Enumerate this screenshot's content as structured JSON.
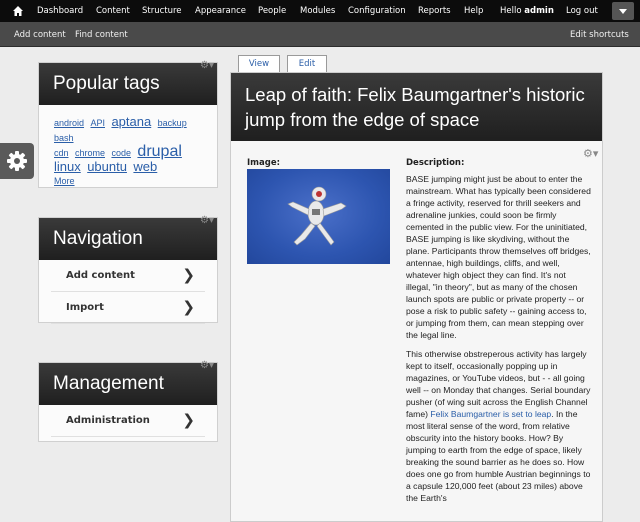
{
  "toolbar": {
    "items": [
      "Dashboard",
      "Content",
      "Structure",
      "Appearance",
      "People",
      "Modules",
      "Configuration",
      "Reports",
      "Help"
    ],
    "hello": "Hello",
    "username": "admin",
    "logout": "Log out"
  },
  "shortcuts": {
    "add_content": "Add content",
    "find_content": "Find content",
    "edit": "Edit shortcuts"
  },
  "blocks": {
    "popular_tags": {
      "title": "Popular tags",
      "tags": [
        "android",
        "API",
        "aptana",
        "backup",
        "bash",
        "cdn",
        "chrome",
        "code",
        "drupal",
        "linux",
        "ubuntu",
        "web"
      ],
      "more": "More"
    },
    "navigation": {
      "title": "Navigation",
      "items": [
        "Add content",
        "Import"
      ]
    },
    "management": {
      "title": "Management",
      "items": [
        "Administration"
      ]
    }
  },
  "tabs": {
    "view": "View",
    "edit": "Edit"
  },
  "article": {
    "title": "Leap of faith: Felix Baumgartner's historic jump from the edge of space",
    "image_label": "Image:",
    "description_label": "Description:",
    "paragraph1": "BASE jumping might just be about to enter the mainstream. What has typically been considered a fringe activity, reserved for thrill seekers and adrenaline junkies, could soon be firmly cemented in the public view. For the uninitiated, BASE jumping is like skydiving, without the plane. Participants throw themselves off bridges, antennae, high buildings, cliffs, and well, whatever high object they can find. It's not illegal, \"in theory\", but as many of the chosen launch spots are public or private property -- or pose a risk to public safety -- gaining access to, or jumping from them, can mean stepping over the legal line.",
    "paragraph2_before": "This otherwise obstreperous activity has largely kept to itself, occasionally popping up in magazines, or YouTube videos, but - - all going well -- on Monday that changes. Serial boundary pusher (of wing suit across the English Channel fame) ",
    "paragraph2_link": "Felix Baumgartner is set to leap",
    "paragraph2_after": ". In the most literal sense of the word, from relative obscurity into the history books. How? By jumping to earth from the edge of space, likely breaking the sound barrier as he does so. How does one go from humble Austrian beginnings to a capsule 120,000 feet (about 23 miles) above the Earth's"
  }
}
